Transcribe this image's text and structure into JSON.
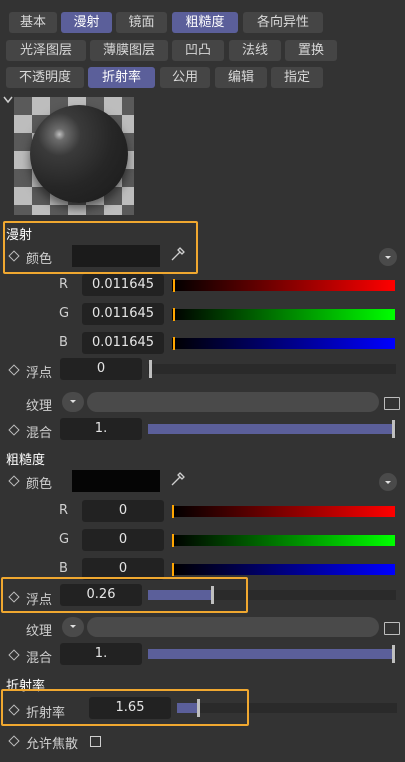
{
  "tabs_row1": [
    "基本",
    "漫射",
    "镜面",
    "粗糙度",
    "各向异性"
  ],
  "tabs_row2": [
    "光泽图层",
    "薄膜图层",
    "凹凸",
    "法线",
    "置换"
  ],
  "tabs_row3": [
    "不透明度",
    "折射率",
    "公用",
    "编辑",
    "指定"
  ],
  "diffuse": {
    "title": "漫射",
    "color_label": "颜色",
    "r_label": "R",
    "r_value": "0.011645",
    "g_label": "G",
    "g_value": "0.011645",
    "b_label": "B",
    "b_value": "0.011645",
    "float_label": "浮点",
    "float_value": "0",
    "texture_label": "纹理",
    "mix_label": "混合",
    "mix_value": "1."
  },
  "roughness": {
    "title": "粗糙度",
    "color_label": "颜色",
    "r_label": "R",
    "r_value": "0",
    "g_label": "G",
    "g_value": "0",
    "b_label": "B",
    "b_value": "0",
    "float_label": "浮点",
    "float_value": "0.26",
    "float_level": 0.26,
    "texture_label": "纹理",
    "mix_label": "混合",
    "mix_value": "1."
  },
  "ior": {
    "title": "折射率",
    "ior_label": "折射率",
    "ior_value": "1.65",
    "caustics_label": "允许焦散"
  },
  "colors": {
    "accent": "#5b5f9a",
    "highlight": "#f0a830"
  }
}
